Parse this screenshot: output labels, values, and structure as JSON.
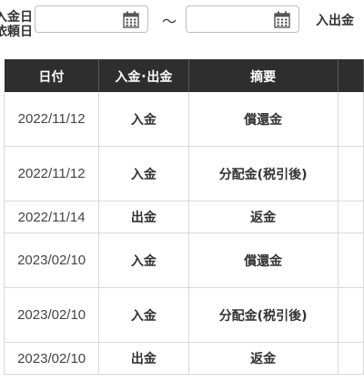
{
  "filter": {
    "label_line1": "入金日",
    "label_line2": "依頼日",
    "from_value": "",
    "to_value": "",
    "range_separator": "～",
    "type_label": "入出金"
  },
  "table": {
    "headers": [
      "日付",
      "入金･出金",
      "摘要",
      ""
    ],
    "rows": [
      {
        "date": "2022/11/12",
        "kind": "入金",
        "summary": "償還金"
      },
      {
        "date": "2022/11/12",
        "kind": "入金",
        "summary": "分配金(税引後)"
      },
      {
        "date": "2022/11/14",
        "kind": "出金",
        "summary": "返金"
      },
      {
        "date": "2023/02/10",
        "kind": "入金",
        "summary": "償還金"
      },
      {
        "date": "2023/02/10",
        "kind": "入金",
        "summary": "分配金(税引後)"
      },
      {
        "date": "2023/02/10",
        "kind": "出金",
        "summary": "返金"
      }
    ]
  },
  "colors": {
    "header_bg": "#2e2e2e",
    "header_text": "#ffffff",
    "border": "#d8d8d8"
  }
}
